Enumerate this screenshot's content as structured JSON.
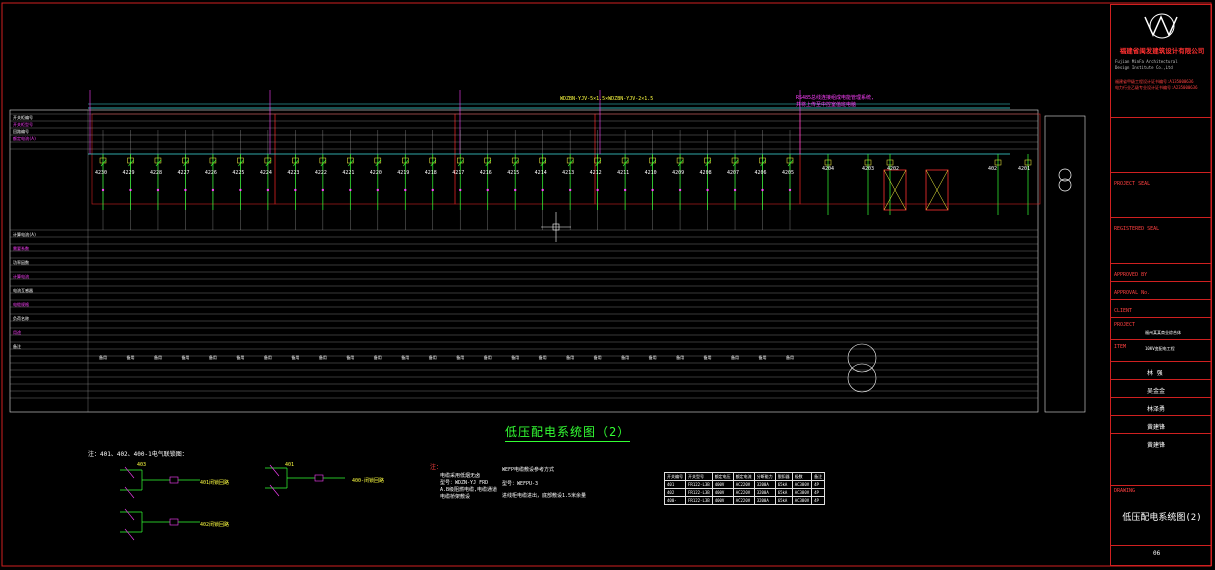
{
  "colors": {
    "background": "#000000",
    "frame": "#d02020",
    "bus": "#40e0e0",
    "title": "#33ff33",
    "magenta": "#ff40ff"
  },
  "diagram": {
    "title": "低压配电系统图（2）",
    "bus_labels": [
      "WDZBN-YJV-5×1.5×WDZBN-YJV-2×1.5"
    ],
    "comm_note": [
      "RS485总线连接组成电能管理系统,",
      "并将上传至中控室值班电脑"
    ],
    "circuits_left": [
      "4230",
      "4229",
      "4228",
      "4227",
      "4226",
      "4225",
      "4224",
      "4223",
      "4222",
      "4221",
      "4220",
      "4219",
      "4218",
      "4217",
      "4216",
      "4215",
      "4214",
      "4213",
      "4212",
      "4211",
      "4210",
      "4209",
      "4208",
      "4207",
      "4206",
      "4205"
    ],
    "circuits_right": [
      "4204",
      "4203",
      "4202",
      "402",
      "4201"
    ],
    "row_headers": [
      "开关柜编号",
      "开关柜型号",
      "回路编号",
      "额定电流(A)",
      "计算电流(A)",
      "需要系数",
      "功率因数",
      "计算电流",
      "电流互感器",
      "电缆规格",
      "负荷名称",
      "用途",
      "备注"
    ],
    "spare_label": "备用"
  },
  "notes": {
    "interlock_title": "注：401、402、400-1电气联锁图：",
    "interlock_1": "401闭锁回路",
    "interlock_2": "400-闭锁回路",
    "interlock_3": "402闭锁回路",
    "note_head": "注：",
    "note_lines": [
      "电缆采用低烟无卤",
      "型号：WDZN-YJ FRD",
      "A.B级阻燃电缆,电缆通道",
      "电缆桥架敷设"
    ],
    "note2_lines": [
      "WEFP电缆敷设参考方式",
      "型号：WEFPU-3",
      "进线柜电缆进出，底部敷设1.5米余量"
    ],
    "left_label": "403",
    "right_label": "401"
  },
  "spec_table": {
    "headers": [
      "开关编号",
      "开关型号",
      "额定电压",
      "额定电流",
      "分断能力",
      "脱扣器",
      "极数",
      "备注"
    ],
    "rows": [
      [
        "401",
        "FR122-L3B",
        "400V",
        "AC220V",
        "3200A",
        "65kA",
        "AC380V",
        "4P"
      ],
      [
        "402",
        "FR122-L3B",
        "400V",
        "AC220V",
        "3200A",
        "65kA",
        "AC380V",
        "4P"
      ],
      [
        "400-",
        "FR122-L3B",
        "400V",
        "AC220V",
        "3200A",
        "65kA",
        "AC380V",
        "4P"
      ]
    ]
  },
  "titleblock": {
    "firm": "福建省闽发建筑设计有限公司",
    "firm_en": [
      "Fujian MinFa Architectural",
      "Design Institute Co.,Ltd"
    ],
    "cert_1": "福建省甲级工程设计证书编号:A135000636",
    "cert_2": "电力行业乙级专业设计证书编号:A235000636",
    "project_seal_label": "PROJECT SEAL",
    "registered_seal_label": "REGISTERED SEAL",
    "approved_label": "APPROVED BY",
    "approval_label": "APPROVAL No.",
    "client_label": "CLIENT",
    "project_label": "PROJECT",
    "project_value": "福州某某商业综合体",
    "item_label": "ITEM",
    "item_value": "10KV变配电工程",
    "checked": "林 强",
    "design": "吴金金",
    "design2": "林泽勇",
    "draw": "黄建锋",
    "check2": "黄建锋",
    "drawing_label": "DRAWING",
    "drawing_title": "低压配电系统图(2)",
    "sheet_no": "06"
  }
}
